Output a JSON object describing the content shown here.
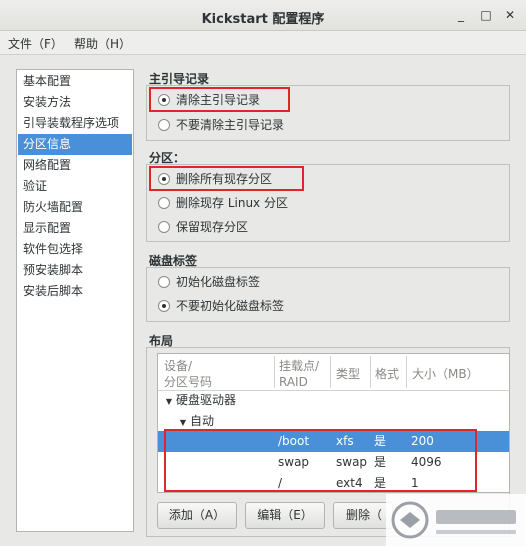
{
  "window": {
    "title": "Kickstart 配置程序",
    "minimize_glyph": "_",
    "maximize_glyph": "□",
    "close_glyph": "✕"
  },
  "menu": {
    "file": "文件（F）",
    "help": "帮助（H）"
  },
  "sidebar": {
    "items": [
      {
        "label": "基本配置"
      },
      {
        "label": "安装方法"
      },
      {
        "label": "引导装载程序选项"
      },
      {
        "label": "分区信息"
      },
      {
        "label": "网络配置"
      },
      {
        "label": "验证"
      },
      {
        "label": "防火墙配置"
      },
      {
        "label": "显示配置"
      },
      {
        "label": "软件包选择"
      },
      {
        "label": "预安装脚本"
      },
      {
        "label": "安装后脚本"
      }
    ],
    "selected_index": 3
  },
  "mbr": {
    "title": "主引导记录",
    "options": [
      {
        "label": "清除主引导记录",
        "checked": true
      },
      {
        "label": "不要清除主引导记录",
        "checked": false
      }
    ]
  },
  "partitions": {
    "title": "分区：",
    "options": [
      {
        "label": "删除所有现存分区",
        "checked": true
      },
      {
        "label": "删除现存 Linux 分区",
        "checked": false
      },
      {
        "label": "保留现存分区",
        "checked": false
      }
    ]
  },
  "disklabel": {
    "title": "磁盘标签",
    "options": [
      {
        "label": "初始化磁盘标签",
        "checked": false
      },
      {
        "label": "不要初始化磁盘标签",
        "checked": true
      }
    ]
  },
  "layout": {
    "title": "布局",
    "columns": {
      "device_line1": "设备/",
      "device_line2": "分区号码",
      "mount_line1": "挂载点/",
      "mount_line2": "RAID",
      "type": "类型",
      "format": "格式",
      "size": "大小（MB）"
    },
    "tree": {
      "root": "硬盘驱动器",
      "child": "自动"
    },
    "rows": [
      {
        "mount": "/boot",
        "type": "xfs",
        "format": "是",
        "size": "200"
      },
      {
        "mount": "swap",
        "type": "swap",
        "format": "是",
        "size": "4096"
      },
      {
        "mount": "/",
        "type": "ext4",
        "format": "是",
        "size": "1"
      }
    ],
    "selected_row": 0
  },
  "buttons": {
    "add": "添加（A）",
    "edit": "编辑（E）",
    "delete": "删除（"
  },
  "colors": {
    "selection": "#4a90d9",
    "highlight_box": "#e0262a"
  }
}
